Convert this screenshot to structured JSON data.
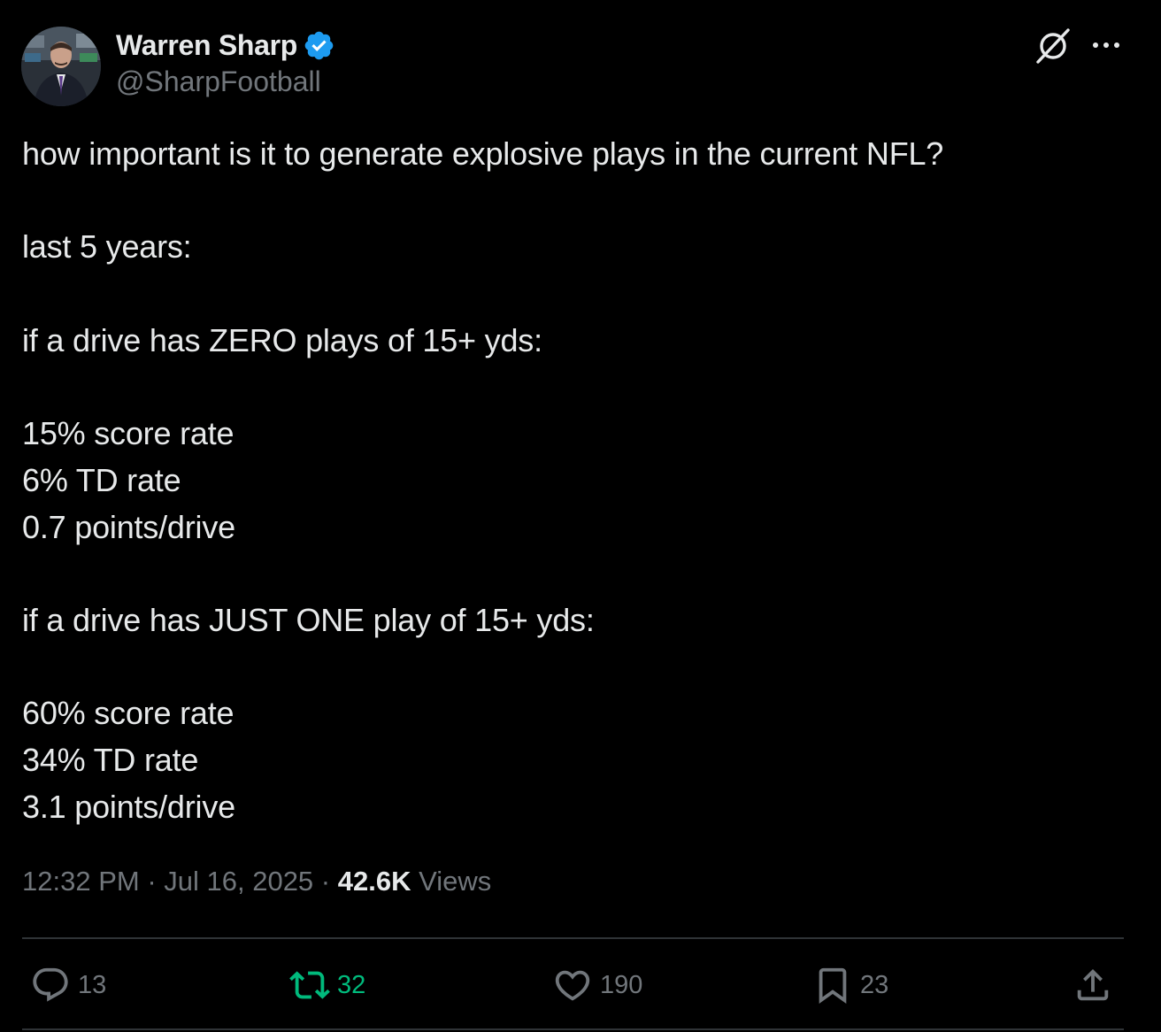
{
  "author": {
    "display_name": "Warren Sharp",
    "handle": "@SharpFootball",
    "verified": true
  },
  "tweet": {
    "lines": [
      "how important is it to generate explosive plays in the current NFL?",
      "",
      "last 5 years:",
      "",
      "if a drive has ZERO plays of 15+ yds:",
      "",
      "15% score rate",
      "6% TD rate",
      "0.7 points/drive",
      "",
      "if a drive has JUST ONE play of 15+ yds:",
      "",
      "60% score rate",
      "34% TD rate",
      "3.1 points/drive"
    ]
  },
  "meta": {
    "time": "12:32 PM",
    "separator": " · ",
    "date": "Jul 16, 2025",
    "views_count": "42.6K",
    "views_label": " Views"
  },
  "actions": {
    "reply_count": "13",
    "retweet_count": "32",
    "like_count": "190",
    "bookmark_count": "23"
  },
  "icons": {
    "grok": "grok-icon",
    "more": "more-icon",
    "reply": "reply-icon",
    "retweet": "retweet-icon",
    "like": "heart-icon",
    "bookmark": "bookmark-icon",
    "share": "share-icon",
    "verified": "verified-badge-icon"
  },
  "colors": {
    "background": "#000000",
    "text_primary": "#e7e9ea",
    "text_secondary": "#71767b",
    "verified_blue": "#1d9bf0",
    "retweet_green": "#00ba7c",
    "divider": "#2f3336"
  }
}
